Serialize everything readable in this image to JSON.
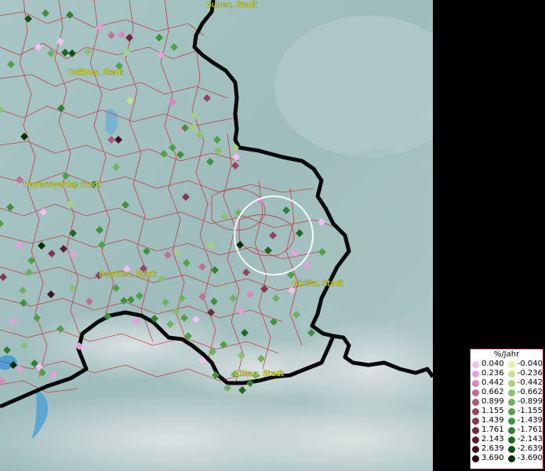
{
  "map": {
    "cities": [
      "Guben, Stadt",
      "Cottbus, Stadt",
      "Hoyerswerda, Stadt",
      "Bautzen, Stadt",
      "Görlitz, Stadt",
      "Zittau, Stadt"
    ]
  },
  "legend": {
    "title": "%/Jahr",
    "positive_colors": [
      "#f4c0f0",
      "#e8a0d8",
      "#d888c0",
      "#c07090",
      "#a85a78",
      "#904860",
      "#803850",
      "#6e2a40",
      "#5a1e30",
      "#401420",
      "#280810"
    ],
    "negative_colors": [
      "#e8f0a0",
      "#c8e090",
      "#a8d080",
      "#88c070",
      "#70b060",
      "#50a048",
      "#409040",
      "#308030",
      "#206820",
      "#105010",
      "#043004"
    ],
    "rows": [
      {
        "pos": "0.040",
        "neg": "-0.040"
      },
      {
        "pos": "0.236",
        "neg": "-0.236"
      },
      {
        "pos": "0.442",
        "neg": "-0.442"
      },
      {
        "pos": "0.662",
        "neg": "-0.662"
      },
      {
        "pos": "0.899",
        "neg": "-0.899"
      },
      {
        "pos": "1.155",
        "neg": "-1.155"
      },
      {
        "pos": "1.439",
        "neg": "-1.439"
      },
      {
        "pos": "1.761",
        "neg": "-1.761"
      },
      {
        "pos": "2.143",
        "neg": "-2.143"
      },
      {
        "pos": "2.639",
        "neg": "-2.639"
      },
      {
        "pos": "3.690",
        "neg": "-3.690"
      }
    ]
  }
}
